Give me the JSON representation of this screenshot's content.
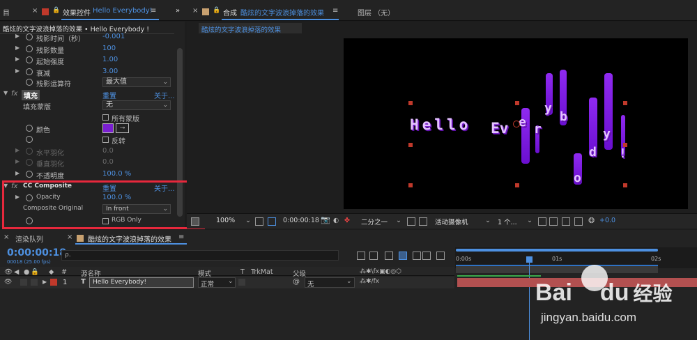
{
  "top_tabs": {
    "left_stub": "目",
    "effects_tab": "效果控件",
    "effects_layer": "Hello Everybody!",
    "comp_tab": "合成",
    "comp_name": "酷炫的文字波浪掉落的效果",
    "layer_tab": "图层 （无）",
    "close": "×",
    "menu": "≡",
    "more": "»"
  },
  "effects": {
    "breadcrumb": "酷炫的文字波浪掉落的效果 • Hello Everybody !",
    "echo_rows": [
      {
        "label": "残影时间（秒）",
        "value": "-0.001"
      },
      {
        "label": "残影数量",
        "value": "100"
      },
      {
        "label": "起始强度",
        "value": "1.00"
      },
      {
        "label": "衰减",
        "value": "3.00"
      },
      {
        "label": "残影运算符",
        "value": "最大值"
      }
    ],
    "fill": {
      "name": "填充",
      "reset": "重置",
      "about": "关于...",
      "mask_label": "填充蒙版",
      "mask_value": "无",
      "all_masks": "所有蒙版",
      "color_label": "颜色",
      "invert": "反转",
      "h_feather": "水平羽化",
      "h_feather_value": "0.0",
      "v_feather": "垂直羽化",
      "v_feather_value": "0.0",
      "opacity_label": "不透明度",
      "opacity_value": "100.0 %"
    },
    "composite": {
      "name": "CC Composite",
      "reset": "重置",
      "about": "关于...",
      "opacity_label": "Opacity",
      "opacity_value": "100.0 %",
      "original_label": "Composite Original",
      "original_value": "In front",
      "rgb_only": "RGB Only"
    },
    "fx_badge": "fx"
  },
  "viewer": {
    "comp_tab_label": "酷炫的文字波浪掉落的效果",
    "text_glyphs": [
      "Hello",
      "Ev",
      "e",
      "r",
      "y",
      "b",
      "o",
      "d",
      "y",
      "!"
    ],
    "toolbar": {
      "zoom": "100%",
      "timecode": "0:00:00:18",
      "resolution": "二分之一",
      "camera": "活动摄像机",
      "views": "1 个...",
      "offset": "+0.0"
    }
  },
  "timeline": {
    "render_queue_tab": "渲染队列",
    "comp_tab": "酷炫的文字波浪掉落的效果",
    "timecode": "0:00:00:18",
    "frame_info": "00018 (25.00 fps)",
    "search_placeholder": "ρ.",
    "headers": {
      "hash": "#",
      "source_name": "源名称",
      "mode": "模式",
      "t": "T",
      "trkmat": "TrkMat",
      "parent": "父级"
    },
    "ruler": [
      "0:00s",
      "01s",
      "02s"
    ],
    "layer": {
      "index": "1",
      "type": "T",
      "name": "Hello  Everybody!",
      "mode": "正常",
      "parent": "无"
    }
  },
  "watermark": {
    "brand": "Bai",
    "brand2": "du",
    "suffix": "经验",
    "url": "jingyan.baidu.com"
  },
  "colors": {
    "accent": "#4d90e0",
    "fill_color": "#7a1fd0",
    "highlight": "#e7283c"
  }
}
